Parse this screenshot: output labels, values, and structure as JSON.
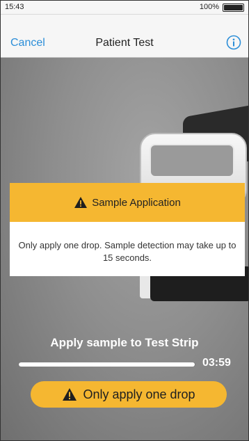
{
  "status_bar": {
    "time": "15:43",
    "battery": "100%",
    "battery_level": 1.0
  },
  "nav": {
    "cancel": "Cancel",
    "title": "Patient Test"
  },
  "dialog": {
    "title": "Sample Application",
    "message": "Only apply one drop.  Sample detection may take up to 15 seconds."
  },
  "instruction": "Apply sample to Test Strip",
  "progress": {
    "fraction": 0.995,
    "timer": "03:59"
  },
  "warning_pill": {
    "text": "Only apply one drop"
  },
  "colors": {
    "accent": "#2b8ed8",
    "warning": "#f5b731",
    "warning_icon": "#1f1f1f"
  },
  "icons": [
    "info-icon",
    "warning-triangle-icon"
  ]
}
